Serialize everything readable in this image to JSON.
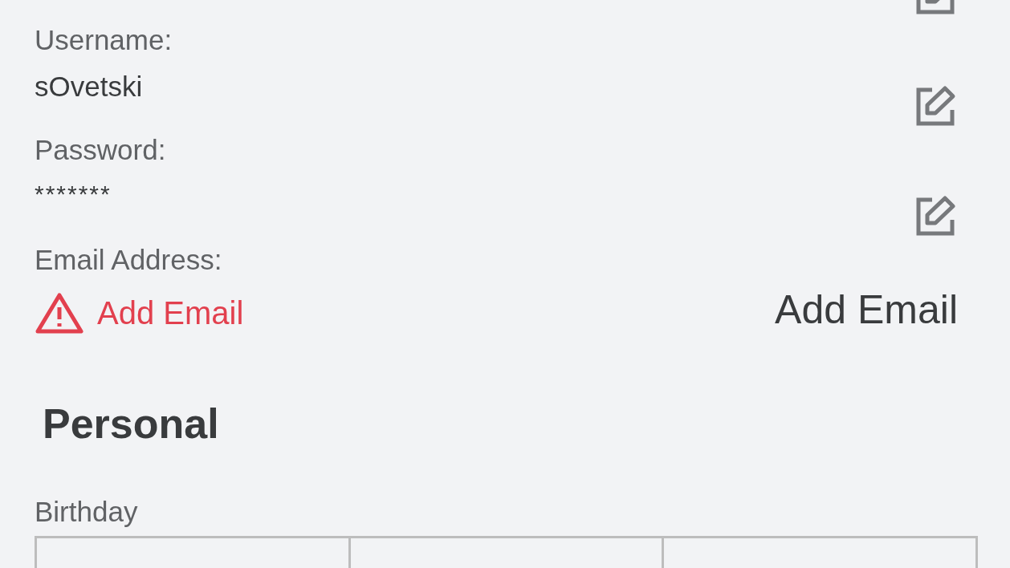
{
  "account_fields": [
    {
      "label": "Username:",
      "value": "sOvetski",
      "kind": "text"
    },
    {
      "label": "Password:",
      "value": "*******",
      "kind": "masked"
    },
    {
      "label": "Email Address:",
      "value": "Add Email",
      "kind": "warning",
      "action": "Add Email"
    }
  ],
  "personal": {
    "heading": "Personal",
    "birthday_label": "Birthday"
  }
}
